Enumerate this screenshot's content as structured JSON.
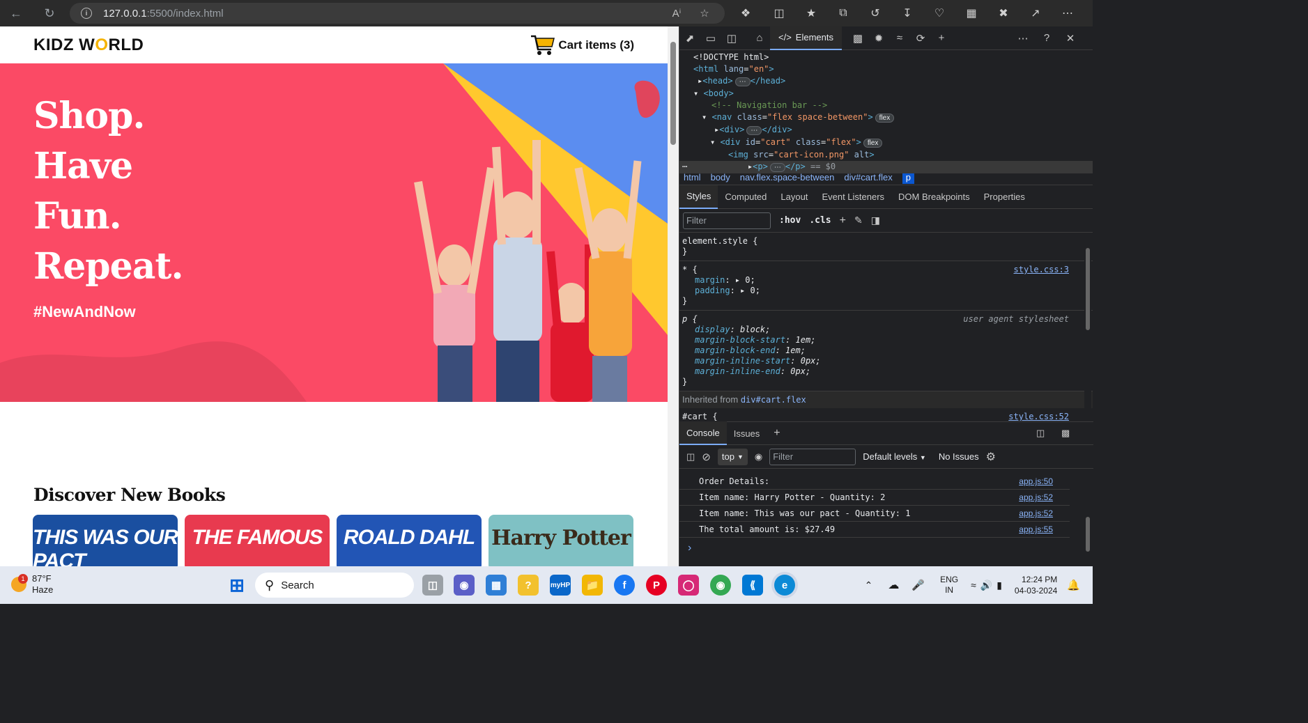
{
  "browser": {
    "url_host": "127.0.0.1",
    "url_rest": ":5500/index.html",
    "info_icon": "i"
  },
  "site": {
    "logo_prefix": "KIDZ W",
    "logo_o": "O",
    "logo_suffix": "RLD",
    "cart_label": "Cart items (3)",
    "hero_lines": [
      "Shop.",
      "Have",
      "Fun.",
      "Repeat."
    ],
    "hashtag": "#NewAndNow",
    "section_title": "Discover New Books",
    "books": [
      {
        "title": "THIS WAS OUR PACT",
        "color": "#1a4fa0"
      },
      {
        "title": "THE FAMOUS",
        "color": "#e83a4f"
      },
      {
        "title": "ROALD DAHL",
        "color": "#2255b5"
      },
      {
        "title": "Harry Potter",
        "color": "#7fc1c4"
      }
    ]
  },
  "devtools": {
    "tab_elements": "Elements",
    "dom": [
      "<!DOCTYPE html>",
      "<html lang=\"en\">",
      "<head>",
      "<body>",
      "<!-- Navigation bar -->",
      "<nav class=\"flex space-between\">",
      "<div>",
      "<div id=\"cart\" class=\"flex\">",
      "<img src=\"cart-icon.png\" alt>",
      "<p>",
      "== $0"
    ],
    "badge_flex": "flex",
    "breadcrumbs": [
      "html",
      "body",
      "nav.flex.space-between",
      "div#cart.flex",
      "p"
    ],
    "subtabs": [
      "Styles",
      "Computed",
      "Layout",
      "Event Listeners",
      "DOM Breakpoints",
      "Properties"
    ],
    "filter_placeholder": "Filter",
    "hov": ":hov",
    "cls": ".cls",
    "rules": {
      "element_style": "element.style {",
      "star_selector": "* {",
      "star_src": "style.css:3",
      "margin": "margin",
      "padding": "padding",
      "zero": "0",
      "p_selector": "p {",
      "ua": "user agent stylesheet",
      "p_props": [
        {
          "name": "display",
          "value": "block"
        },
        {
          "name": "margin-block-start",
          "value": "1em"
        },
        {
          "name": "margin-block-end",
          "value": "1em"
        },
        {
          "name": "margin-inline-start",
          "value": "0px"
        },
        {
          "name": "margin-inline-end",
          "value": "0px"
        }
      ],
      "inherited_label": "Inherited from",
      "inherited_from": "div#cart.flex",
      "cart_selector": "#cart {",
      "cart_src": "style.css:52"
    },
    "console_tabs": [
      "Console",
      "Issues"
    ],
    "console_toolbar": {
      "context": "top",
      "filter": "Filter",
      "levels": "Default levels",
      "issues": "No Issues"
    },
    "console_log": [
      {
        "text": "Order Details:",
        "src": "app.js:50"
      },
      {
        "text": "Item name: Harry Potter - Quantity: 2",
        "src": "app.js:52"
      },
      {
        "text": "Item name: This was our pact - Quantity: 1",
        "src": "app.js:52"
      },
      {
        "text": "The total amount is: $27.49",
        "src": "app.js:55"
      }
    ]
  },
  "taskbar": {
    "weather_temp": "87°F",
    "weather_desc": "Haze",
    "weather_badge": "1",
    "search": "Search",
    "lang_top": "ENG",
    "lang_bottom": "IN",
    "time": "12:24 PM",
    "date": "04-03-2024"
  }
}
